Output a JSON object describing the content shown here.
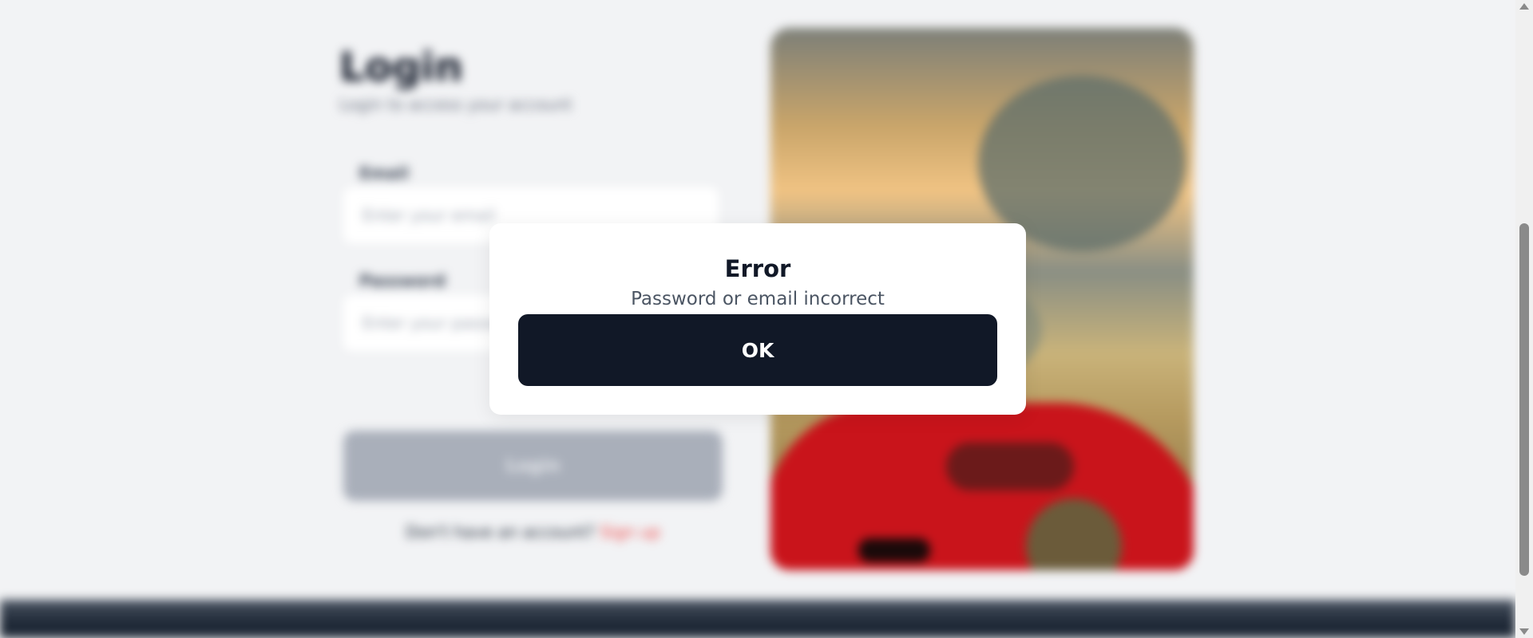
{
  "login_page": {
    "title": "Login",
    "subtitle": "Login to access your account",
    "email_label": "Email",
    "email_placeholder": "Enter your email",
    "password_label": "Password",
    "password_placeholder": "Enter your password",
    "login_button": "Login",
    "signup_prompt": "Don't have an account?",
    "signup_link": "Sign up"
  },
  "dialog": {
    "title": "Error",
    "message": "Password or email incorrect",
    "ok_label": "OK"
  },
  "colors": {
    "modal_bg": "#ffffff",
    "button_bg": "#111827",
    "page_bg": "#f2f3f5",
    "disabled_button": "#a9afba",
    "link": "#ef4444"
  },
  "icons": {
    "scroll_up": "scroll-up-arrow-icon",
    "scroll_down": "scroll-down-arrow-icon"
  }
}
